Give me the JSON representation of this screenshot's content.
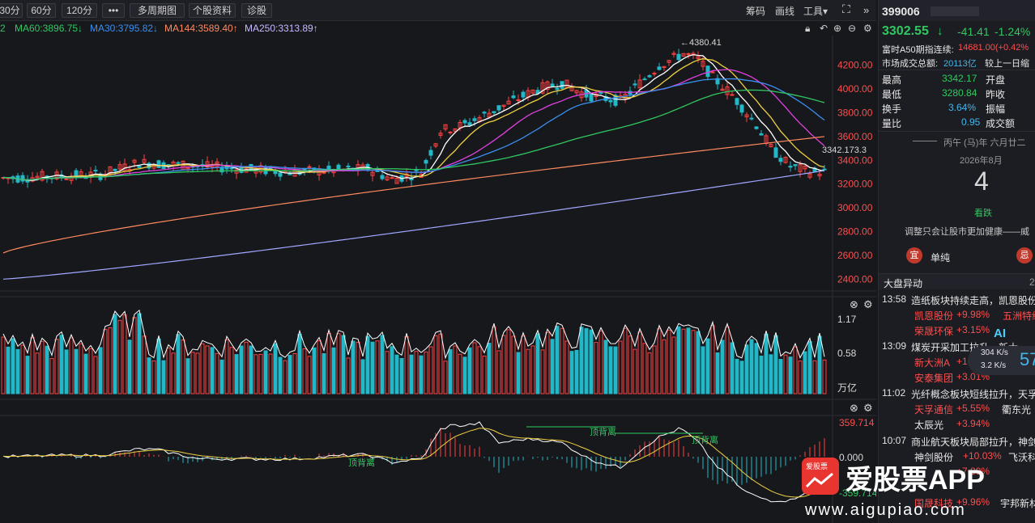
{
  "toolbar": {
    "periods": [
      "30分",
      "60分",
      "120分",
      "•••",
      "多周期图",
      "个股资料",
      "诊股"
    ],
    "right": [
      "筹码",
      "画线",
      "工具▾"
    ],
    "expand_icon": "fullscreen-icon",
    "collapse_icon": "double-chevron-right-icon"
  },
  "ma": {
    "lead": "2",
    "ma60": "MA60:3896.75↓",
    "ma30": "MA30:3795.82↓",
    "ma144": "MA144:3589.40↑",
    "ma250": "MA250:3313.89↑",
    "colors": {
      "ma60": "#30c860",
      "ma30": "#3a8ff0",
      "ma144": "#ff8a60",
      "ma250": "#a0a8ff"
    }
  },
  "price_axis": {
    "ticks": [
      "4200.00",
      "4000.00",
      "3800.00",
      "3600.00",
      "3400.00",
      "3200.00",
      "3000.00",
      "2800.00",
      "2600.00",
      "2400.00"
    ],
    "high_marker": "←4380.41",
    "current_label": "3342.17",
    "current_label_overlap": "3.3"
  },
  "volume_axis": {
    "ticks": [
      "1.17",
      "0.58"
    ],
    "unit": "万亿"
  },
  "macd_axis": {
    "top": "359.714",
    "zero": "0.000",
    "bottom": "-359.714"
  },
  "macd_labels": [
    "顶背离",
    "顶背离",
    "顶背离"
  ],
  "sidebar": {
    "code": "399006",
    "price": "3302.55",
    "price_arrow": "↓",
    "change": "-41.41",
    "change_pct": "-1.24%",
    "futures_label": "富时A50期指连续:",
    "futures_value": "14681.00(+0.42%",
    "turnover_label": "市场成交总额:",
    "turnover_value": "20113亿",
    "turnover_compare": "较上一日缩",
    "stats": [
      {
        "label": "最高",
        "value": "3342.17",
        "label2": "开盘"
      },
      {
        "label": "最低",
        "value": "3280.84",
        "label2": "昨收"
      },
      {
        "label": "换手",
        "value": "3.64%",
        "label2": "振幅"
      },
      {
        "label": "量比",
        "value": "0.95",
        "label2": "成交额"
      }
    ],
    "lunar": "丙午 (马)年 六月廿二",
    "month": "2026年8月",
    "day": "4",
    "day_note": "看跌",
    "quote": "调整只会让股市更加健康——威",
    "yi_badge": "宜",
    "yi_text": "单纯",
    "ji_badge": "忌",
    "alerts_title": "大盘异动",
    "alerts_more": "2",
    "news": [
      {
        "time": "13:58",
        "title": "造纸板块持续走高，凯恩股份涨",
        "stocks": [
          [
            "凯恩股份",
            "+9.98%",
            "五洲特纸"
          ],
          [
            "荣晟环保",
            "+3.15%",
            ""
          ]
        ]
      },
      {
        "time": "13:09",
        "title": "煤炭开采加工拉升，新大",
        "stocks": [
          [
            "新大洲A",
            "+10",
            ""
          ],
          [
            "安泰集团",
            "+3.01%",
            ""
          ]
        ]
      },
      {
        "time": "11:02",
        "title": "光纤概念板块短线拉升，天孚通",
        "stocks": [
          [
            "天孚通信",
            "+5.55%",
            "衢东光"
          ],
          [
            "太辰光",
            "+3.94%",
            ""
          ]
        ]
      },
      {
        "time": "10:07",
        "title": "商业航天板块局部拉升，神剑股",
        "stocks": [
          [
            "神剑股份",
            "+10.03%",
            "飞沃科技"
          ],
          [
            "",
            "+7.89%",
            ""
          ],
          [
            "国晟科技",
            "+9.96%",
            "宇邦新材"
          ]
        ]
      }
    ],
    "net_up": "304 K/s",
    "net_down": "3.2 K/s",
    "ai_label": "AI",
    "net_percent": "57"
  },
  "watermark": {
    "brand": "爱股票APP",
    "url": "www.aigupiao.com",
    "logo_text": "爱股票"
  },
  "chart_data": {
    "type": "candlestick",
    "ylim": [
      2300,
      4450
    ],
    "high_marked": 4380.41,
    "last_close": 3302.55
  }
}
